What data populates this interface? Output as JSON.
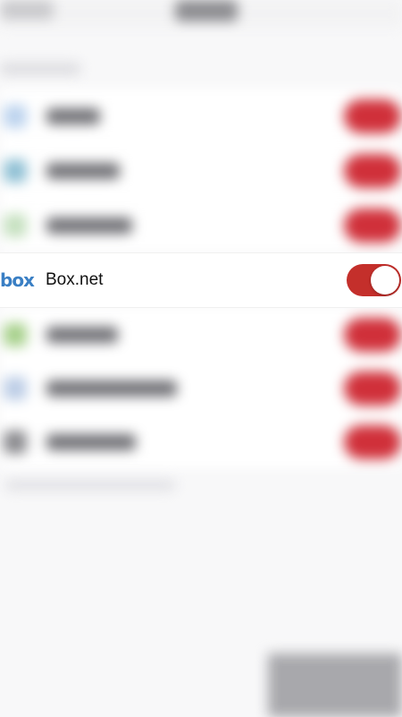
{
  "focused_row": {
    "logo_text": "box",
    "label": "Box.net",
    "toggle_on": true,
    "toggle_color": "#c42f2b",
    "logo_color": "#3a7fc4"
  },
  "blurred_rows": [
    {
      "icon_color": "#bcd3ee"
    },
    {
      "icon_color": "#8fc0d4"
    },
    {
      "icon_color": "#c5e0bf"
    },
    {
      "icon_color": "#a6d08a"
    },
    {
      "icon_color": "#bccde6"
    },
    {
      "icon_color": "#8a8a8e"
    }
  ]
}
